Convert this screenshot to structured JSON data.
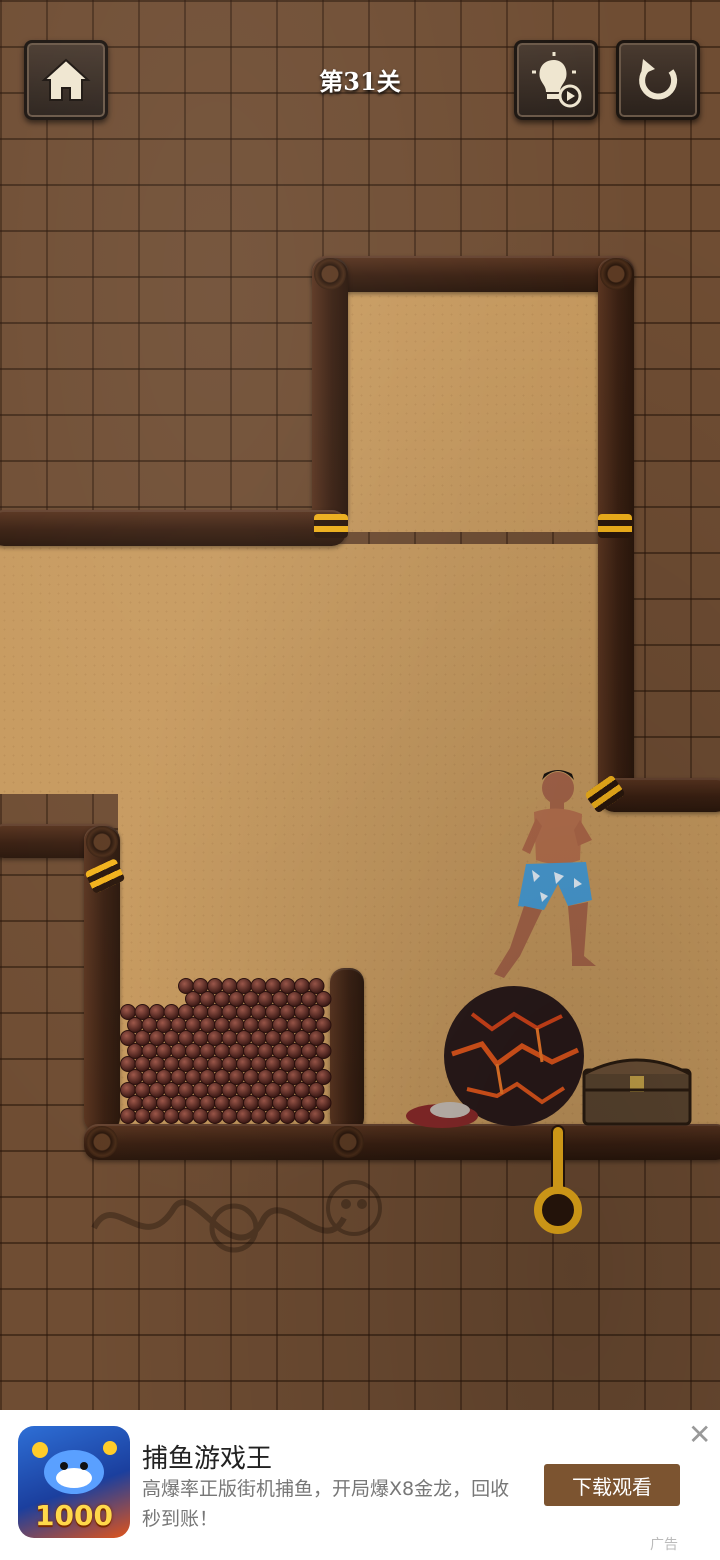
{
  "header": {
    "level_title": "第31关"
  },
  "icons": {
    "home": "home-icon",
    "hint": "lightbulb-video-icon",
    "restart": "restart-icon"
  },
  "ad": {
    "title": "捕鱼游戏王",
    "description": "高爆率正版街机捕鱼，开局爆X8金龙，回收秒到账！",
    "button": "下载观看",
    "close": "✕",
    "label": "广告",
    "icon_text": "1000"
  },
  "colors": {
    "sand": "#c79a5f",
    "wall": "#6f4d33",
    "log": "#3a2012",
    "pin": "#f2b21b",
    "ad_button": "#7c5430"
  }
}
